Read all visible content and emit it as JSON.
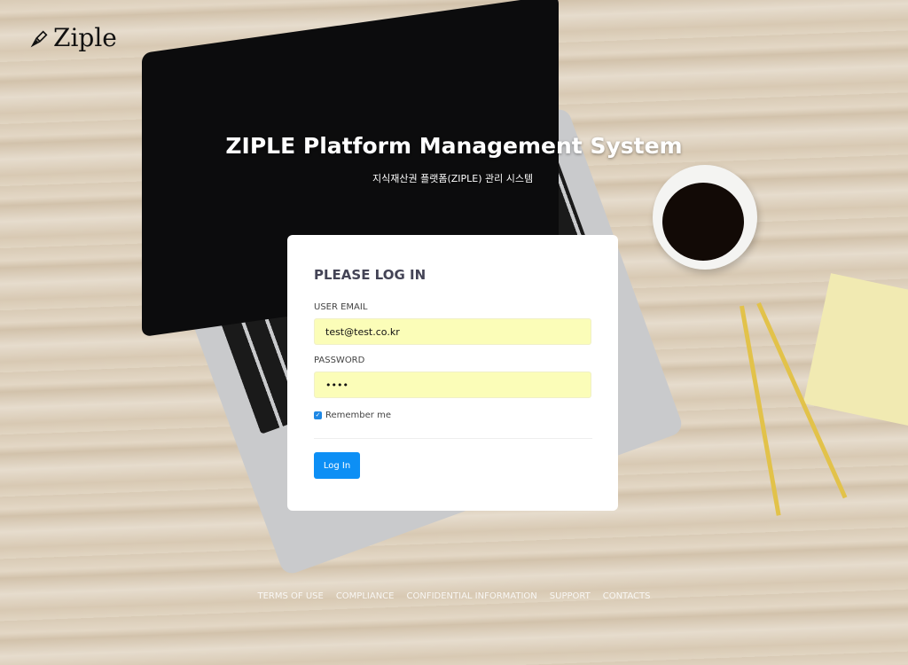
{
  "brand": {
    "name": "Ziple",
    "icon": "fountain-pen-icon"
  },
  "header": {
    "title": "ZIPLE Platform Management System",
    "subtitle": "지식재산권 플랫폼(ZIPLE) 관리 시스템"
  },
  "login": {
    "heading": "PLEASE LOG IN",
    "email_label": "USER EMAIL",
    "email_value": "test@test.co.kr",
    "password_label": "PASSWORD",
    "password_value": "test",
    "remember_label": "Remember me",
    "remember_checked": true,
    "submit_label": "Log In",
    "accent": "#0d8ff5"
  },
  "footer": {
    "links": [
      "TERMS OF USE",
      "COMPLIANCE",
      "CONFIDENTIAL INFORMATION",
      "SUPPORT",
      "CONTACTS"
    ]
  }
}
